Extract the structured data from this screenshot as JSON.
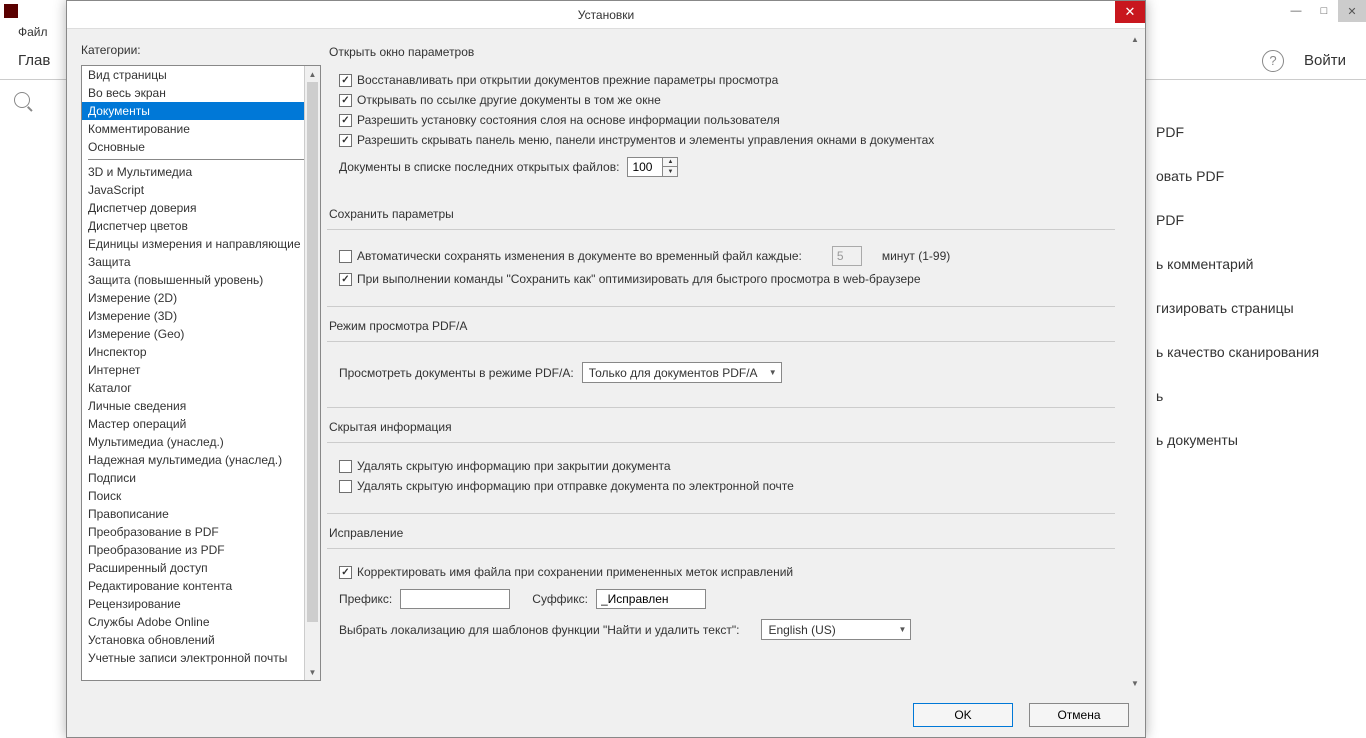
{
  "bg": {
    "menu_file": "Файл",
    "tab_home": "Глав",
    "login": "Войти",
    "right_items": [
      "PDF",
      "овать PDF",
      "PDF",
      "ь комментарий",
      "гизировать страницы",
      "ь качество сканирования",
      "ь",
      "ь документы"
    ]
  },
  "dialog": {
    "title": "Установки",
    "categories_label": "Категории:",
    "categories_a": [
      "Вид страницы",
      "Во весь экран",
      "Документы",
      "Комментирование",
      "Основные"
    ],
    "categories_b": [
      "3D и Мультимедиа",
      "JavaScript",
      "Диспетчер доверия",
      "Диспетчер цветов",
      "Единицы измерения и направляющие",
      "Защита",
      "Защита (повышенный уровень)",
      "Измерение (2D)",
      "Измерение (3D)",
      "Измерение (Geo)",
      "Инспектор",
      "Интернет",
      "Каталог",
      "Личные сведения",
      "Мастер операций",
      "Мультимедиа (унаслед.)",
      "Надежная мультимедиа (унаслед.)",
      "Подписи",
      "Поиск",
      "Правописание",
      "Преобразование в PDF",
      "Преобразование из PDF",
      "Расширенный доступ",
      "Редактирование контента",
      "Рецензирование",
      "Службы Adobe Online",
      "Установка обновлений",
      "Учетные записи электронной почты"
    ],
    "selected_index": 2,
    "ok": "OK",
    "cancel": "Отмена"
  },
  "open": {
    "title": "Открыть окно параметров",
    "c1": "Восстанавливать при открытии документов прежние параметры просмотра",
    "c2": "Открывать по ссылке другие документы в том же окне",
    "c3": "Разрешить установку состояния слоя на основе информации пользователя",
    "c4": "Разрешить скрывать панель меню, панели инструментов и элементы управления окнами в документах",
    "recent_label": "Документы в списке последних открытых файлов:",
    "recent_value": "100"
  },
  "save": {
    "title": "Сохранить параметры",
    "autosave": "Автоматически сохранять изменения в документе во временный файл каждые:",
    "autosave_value": "5",
    "autosave_unit": "минут (1-99)",
    "optimize": "При выполнении команды \"Сохранить как\" оптимизировать для быстрого просмотра в web-браузере"
  },
  "pdfa": {
    "title": "Режим просмотра PDF/A",
    "label": "Просмотреть документы в режиме PDF/A:",
    "value": "Только для документов PDF/A"
  },
  "hidden": {
    "title": "Скрытая информация",
    "c1": "Удалять скрытую информацию при закрытии документа",
    "c2": "Удалять скрытую информацию при отправке документа по электронной почте"
  },
  "redact": {
    "title": "Исправление",
    "c1": "Корректировать имя файла при сохранении примененных меток исправлений",
    "prefix_label": "Префикс:",
    "prefix_value": "",
    "suffix_label": "Суффикс:",
    "suffix_value": "_Исправлен",
    "locale_label": "Выбрать локализацию для шаблонов функции \"Найти и удалить текст\":",
    "locale_value": "English (US)"
  }
}
